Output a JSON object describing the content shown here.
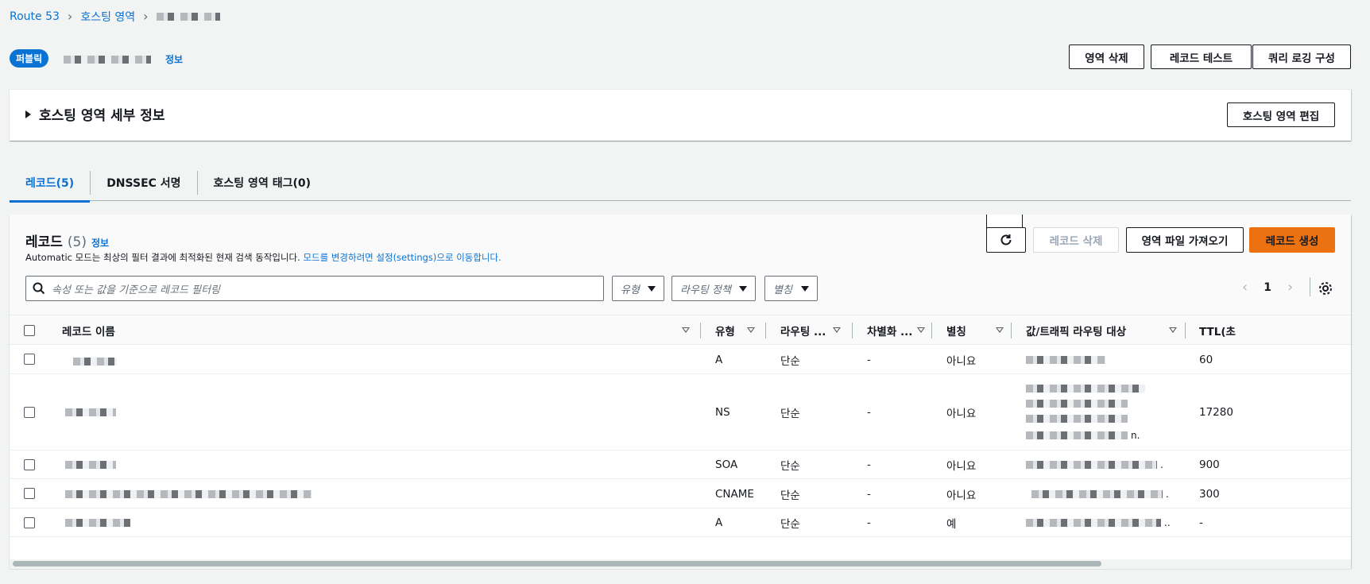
{
  "breadcrumb": {
    "root": "Route 53",
    "section": "호스팅 영역",
    "separator": ">"
  },
  "zone": {
    "badge": "퍼블릭",
    "info": "정보"
  },
  "actions": {
    "delete_zone": "영역 삭제",
    "test_record": "레코드 테스트",
    "query_logging": "쿼리 로깅 구성"
  },
  "details": {
    "title": "호스팅 영역 세부 정보",
    "edit": "호스팅 영역 편집"
  },
  "tabs": [
    {
      "label": "레코드(5)",
      "active": true
    },
    {
      "label": "DNSSEC 서명",
      "active": false
    },
    {
      "label": "호스팅 영역 태그(0)",
      "active": false
    }
  ],
  "records": {
    "title": "레코드",
    "count": "(5)",
    "info": "정보",
    "desc_prefix": "Automatic 모드는 최상의 필터 결과에 최적화된 현재 검색 동작입니다.",
    "desc_link": "모드를 변경하려면 설정(settings)으로 이동합니다.",
    "btn_delete": "레코드 삭제",
    "btn_import": "영역 파일 가져오기",
    "btn_create": "레코드 생성",
    "search_placeholder": "속성 또는 값을 기준으로 레코드 필터링",
    "filter_type": "유형",
    "filter_routing": "라우팅 정책",
    "filter_alias": "별칭",
    "page": "1"
  },
  "columns": [
    "레코드 이름",
    "유형",
    "라우팅 ...",
    "차별화 ...",
    "별칭",
    "값/트래픽 라우팅 대상",
    "TTL(초"
  ],
  "rows": [
    {
      "type": "A",
      "routing": "단순",
      "diff": "-",
      "alias": "아니요",
      "value_suffix": "",
      "ttl": "60"
    },
    {
      "type": "NS",
      "routing": "단순",
      "diff": "-",
      "alias": "아니요",
      "value_suffix": "n.",
      "ttl": "17280"
    },
    {
      "type": "SOA",
      "routing": "단순",
      "diff": "-",
      "alias": "아니요",
      "value_suffix": ".",
      "ttl": "900"
    },
    {
      "type": "CNAME",
      "routing": "단순",
      "diff": "-",
      "alias": "아니요",
      "value_suffix": ".",
      "ttl": "300"
    },
    {
      "type": "A",
      "routing": "단순",
      "diff": "-",
      "alias": "예",
      "value_suffix": "..",
      "ttl": "-"
    }
  ],
  "colors": {
    "link": "#0972d3",
    "primary_button": "#ec7211",
    "background": "#f2f3f3"
  },
  "icons": [
    "chevron-right-icon",
    "caret-right-icon",
    "refresh-icon",
    "search-icon",
    "caret-down-icon",
    "chevron-left-icon",
    "settings-icon",
    "sort-icon"
  ]
}
